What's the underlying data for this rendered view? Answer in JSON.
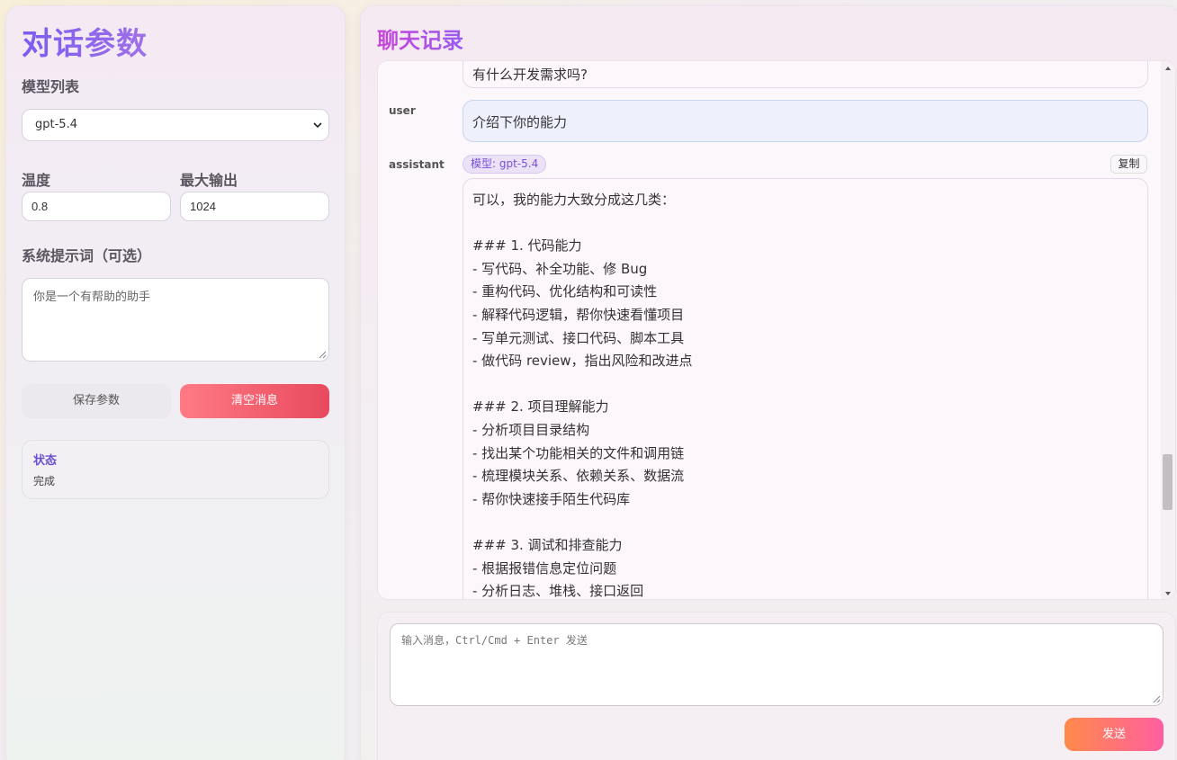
{
  "settings": {
    "title": "对话参数",
    "model_label": "模型列表",
    "model_selected": "gpt-5.4",
    "temperature_label": "温度",
    "temperature_value": "0.8",
    "max_output_label": "最大输出",
    "max_output_value": "1024",
    "system_prompt_label": "系统提示词（可选）",
    "system_prompt_placeholder": "你是一个有帮助的助手",
    "save_label": "保存参数",
    "clear_label": "清空消息",
    "status_title": "状态",
    "status_value": "完成"
  },
  "chat": {
    "title": "聊天记录",
    "previous_tail": "有什么开发需求吗?",
    "user_role": "user",
    "user_message": "介绍下你的能力",
    "assistant_role": "assistant",
    "model_badge": "模型: gpt-5.4",
    "copy_label": "复制",
    "assistant_lines": [
      "可以，我的能力大致分成这几类：",
      "",
      "### 1. 代码能力",
      "- 写代码、补全功能、修 Bug",
      "- 重构代码、优化结构和可读性",
      "- 解释代码逻辑，帮你快速看懂项目",
      "- 写单元测试、接口代码、脚本工具",
      "- 做代码 review，指出风险和改进点",
      "",
      "### 2. 项目理解能力",
      "- 分析项目目录结构",
      "- 找出某个功能相关的文件和调用链",
      "- 梳理模块关系、依赖关系、数据流",
      "- 帮你快速接手陌生代码库",
      "",
      "### 3. 调试和排查能力",
      "- 根据报错信息定位问题",
      "- 分析日志、堆栈、接口返回"
    ]
  },
  "composer": {
    "placeholder": "输入消息，Ctrl/Cmd + Enter 发送",
    "send_label": "发送"
  },
  "colors": {
    "accent_purple": "#7b5cf0",
    "clear_red": "#e84a5e",
    "send_orange": "#ff8a4a",
    "send_pink": "#ff5fa0"
  }
}
